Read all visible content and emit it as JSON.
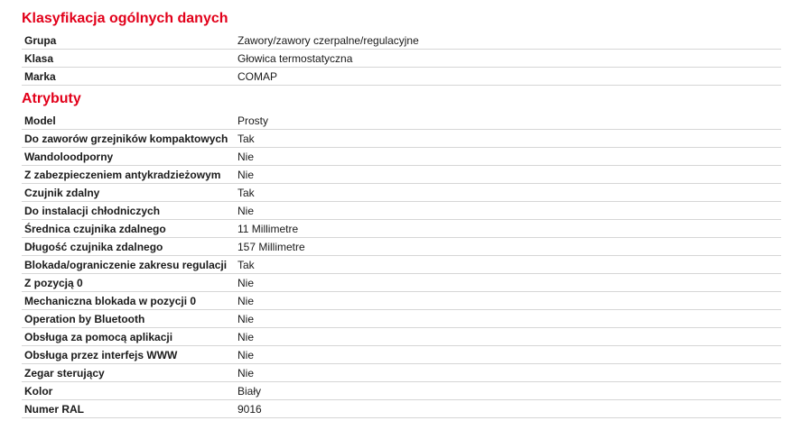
{
  "colors": {
    "heading": "#e2001a",
    "text": "#1a1a1a",
    "row_border": "#d6d6d6"
  },
  "classification": {
    "title": "Klasyfikacja ogólnych danych",
    "rows": [
      {
        "label": "Grupa",
        "value": "Zawory/zawory czerpalne/regulacyjne"
      },
      {
        "label": "Klasa",
        "value": "Głowica termostatyczna"
      },
      {
        "label": "Marka",
        "value": "COMAP"
      }
    ]
  },
  "attributes": {
    "title": "Atrybuty",
    "rows": [
      {
        "label": "Model",
        "value": "Prosty"
      },
      {
        "label": "Do zaworów grzejników kompaktowych",
        "value": "Tak"
      },
      {
        "label": "Wandoloodporny",
        "value": "Nie"
      },
      {
        "label": "Z zabezpieczeniem antykradzieżowym",
        "value": "Nie"
      },
      {
        "label": "Czujnik zdalny",
        "value": "Tak"
      },
      {
        "label": "Do instalacji chłodniczych",
        "value": "Nie"
      },
      {
        "label": "Średnica czujnika zdalnego",
        "value": "11 Millimetre"
      },
      {
        "label": "Długość czujnika zdalnego",
        "value": "157 Millimetre"
      },
      {
        "label": "Blokada/ograniczenie zakresu regulacji",
        "value": "Tak"
      },
      {
        "label": "Z pozycją 0",
        "value": "Nie"
      },
      {
        "label": "Mechaniczna blokada w pozycji 0",
        "value": "Nie"
      },
      {
        "label": "Operation by Bluetooth",
        "value": "Nie"
      },
      {
        "label": "Obsługa za pomocą aplikacji",
        "value": "Nie"
      },
      {
        "label": "Obsługa przez interfejs WWW",
        "value": "Nie"
      },
      {
        "label": "Zegar sterujący",
        "value": "Nie"
      },
      {
        "label": "Kolor",
        "value": "Biały"
      },
      {
        "label": "Numer RAL",
        "value": "9016"
      }
    ]
  }
}
